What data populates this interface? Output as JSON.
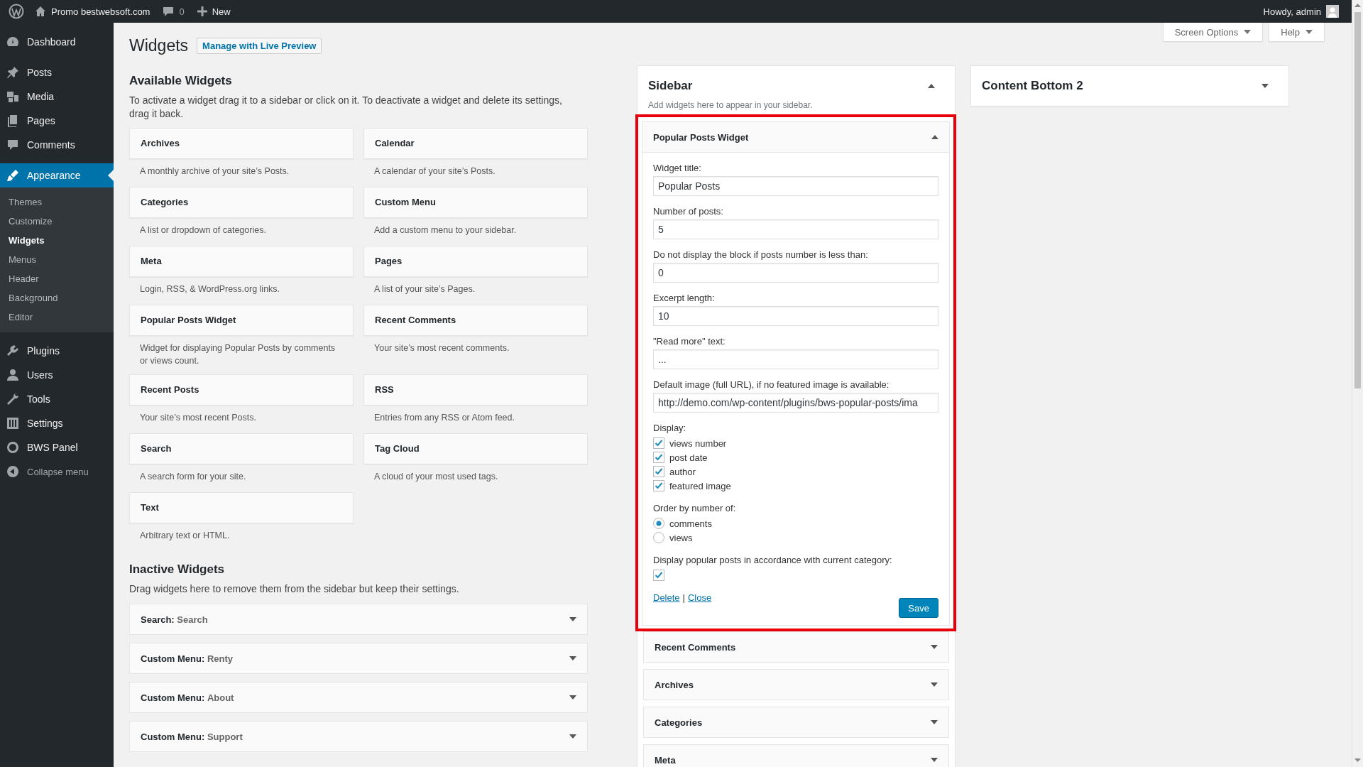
{
  "admin_bar": {
    "site": "Promo bestwebsoft.com",
    "comments_count": "0",
    "new": "New",
    "greeting": "Howdy, admin"
  },
  "menu": {
    "items": [
      {
        "label": "Dashboard",
        "selected": false
      },
      {
        "label": "Posts",
        "selected": false
      },
      {
        "label": "Media",
        "selected": false
      },
      {
        "label": "Pages",
        "selected": false
      },
      {
        "label": "Comments",
        "selected": false
      },
      {
        "label": "Appearance",
        "selected": true,
        "children": [
          {
            "label": "Themes",
            "selected": false
          },
          {
            "label": "Customize",
            "selected": false
          },
          {
            "label": "Widgets",
            "selected": true
          },
          {
            "label": "Menus",
            "selected": false
          },
          {
            "label": "Header",
            "selected": false
          },
          {
            "label": "Background",
            "selected": false
          },
          {
            "label": "Editor",
            "selected": false
          }
        ]
      },
      {
        "label": "Plugins",
        "selected": false
      },
      {
        "label": "Users",
        "selected": false
      },
      {
        "label": "Tools",
        "selected": false
      },
      {
        "label": "Settings",
        "selected": false
      },
      {
        "label": "BWS Panel",
        "selected": false
      }
    ],
    "collapse": "Collapse menu"
  },
  "screen_meta": [
    "Screen Options",
    "Help"
  ],
  "page": {
    "title": "Widgets",
    "live_preview": "Manage with Live Preview"
  },
  "available": {
    "title": "Available Widgets",
    "description": "To activate a widget drag it to a sidebar or click on it. To deactivate a widget and delete its settings, drag it back.",
    "widgets": [
      {
        "name": "Archives",
        "description": "A monthly archive of your site’s Posts."
      },
      {
        "name": "Calendar",
        "description": "A calendar of your site’s Posts."
      },
      {
        "name": "Categories",
        "description": "A list or dropdown of categories."
      },
      {
        "name": "Custom Menu",
        "description": "Add a custom menu to your sidebar."
      },
      {
        "name": "Meta",
        "description": "Login, RSS, & WordPress.org links."
      },
      {
        "name": "Pages",
        "description": "A list of your site’s Pages."
      },
      {
        "name": "Popular Posts Widget",
        "description": "Widget for displaying Popular Posts by comments or views count."
      },
      {
        "name": "Recent Comments",
        "description": "Your site’s most recent comments."
      },
      {
        "name": "Recent Posts",
        "description": "Your site’s most recent Posts."
      },
      {
        "name": "RSS",
        "description": "Entries from any RSS or Atom feed."
      },
      {
        "name": "Search",
        "description": "A search form for your site."
      },
      {
        "name": "Tag Cloud",
        "description": "A cloud of your most used tags."
      },
      {
        "name": "Text",
        "description": "Arbitrary text or HTML."
      }
    ]
  },
  "inactive": {
    "title": "Inactive Widgets",
    "description": "Drag widgets here to remove them from the sidebar but keep their settings.",
    "widgets": [
      {
        "name": "Search:",
        "title": "Search",
        "expanded": false
      },
      {
        "name": "Custom Menu:",
        "title": "Renty",
        "expanded": false
      },
      {
        "name": "Custom Menu:",
        "title": "About",
        "expanded": false
      },
      {
        "name": "Custom Menu:",
        "title": "Support",
        "expanded": false
      }
    ]
  },
  "sidebars": [
    {
      "title": "Sidebar",
      "description": "Add widgets here to appear in your sidebar.",
      "expanded": true,
      "widgets": [
        {
          "name": "Popular Posts Widget",
          "expanded": true,
          "highlighted": true,
          "form": [
            {
              "kind": "text",
              "label": "Widget title:",
              "value": "Popular Posts"
            },
            {
              "kind": "text",
              "label": "Number of posts:",
              "value": "5"
            },
            {
              "kind": "text",
              "label": "Do not display the block if posts number is less than:",
              "value": "0"
            },
            {
              "kind": "text",
              "label": "Excerpt length:",
              "value": "10"
            },
            {
              "kind": "text",
              "label": "\"Read more\" text:",
              "value": "..."
            },
            {
              "kind": "text",
              "label": "Default image (full URL), if no featured image is available:",
              "value": "http://demo.com/wp-content/plugins/bws-popular-posts/ima"
            },
            {
              "kind": "checks",
              "label": "Display:",
              "options": [
                {
                  "label": "views number",
                  "checked": true
                },
                {
                  "label": "post date",
                  "checked": true
                },
                {
                  "label": "author",
                  "checked": true
                },
                {
                  "label": "featured image",
                  "checked": true
                }
              ]
            },
            {
              "kind": "radios",
              "label": "Order by number of:",
              "options": [
                {
                  "label": "comments",
                  "selected": true
                },
                {
                  "label": "views",
                  "selected": false
                }
              ]
            },
            {
              "kind": "checkbox",
              "label": "Display popular posts in accordance with current category:",
              "checked": true
            }
          ],
          "links": [
            "Delete",
            "Close"
          ],
          "separator": "|",
          "save": "Save"
        },
        {
          "name": "Recent Comments",
          "expanded": false,
          "highlighted": false
        },
        {
          "name": "Archives",
          "expanded": false,
          "highlighted": false
        },
        {
          "name": "Categories",
          "expanded": false,
          "highlighted": false
        },
        {
          "name": "Meta",
          "expanded": false,
          "highlighted": false
        }
      ]
    },
    {
      "title": "Content Bottom 2",
      "expanded": false
    }
  ]
}
